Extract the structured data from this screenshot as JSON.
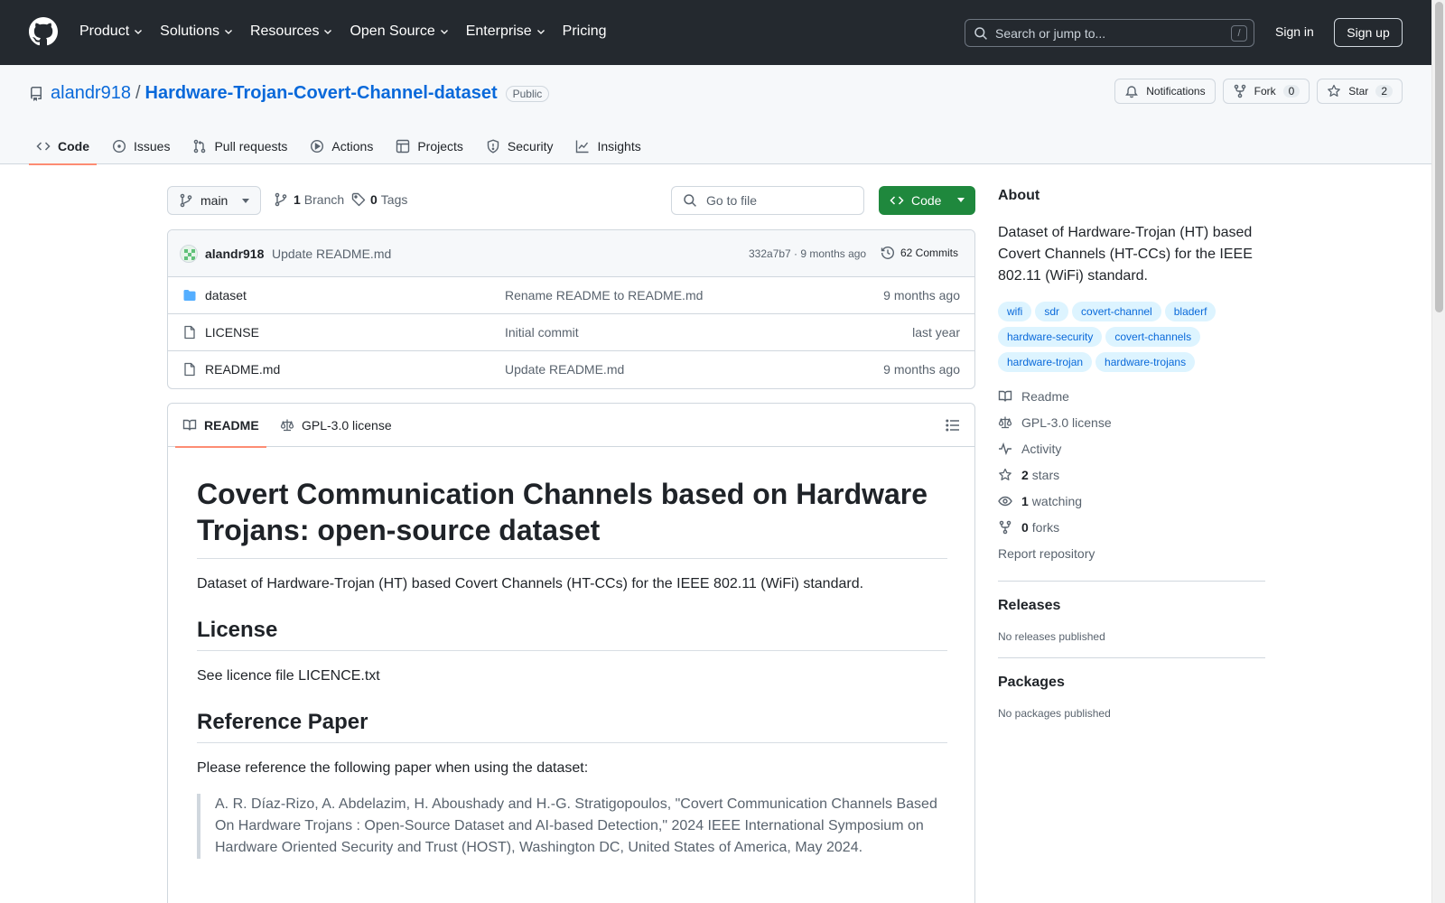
{
  "header": {
    "nav": [
      {
        "label": "Product",
        "has_caret": true
      },
      {
        "label": "Solutions",
        "has_caret": true
      },
      {
        "label": "Resources",
        "has_caret": true
      },
      {
        "label": "Open Source",
        "has_caret": true
      },
      {
        "label": "Enterprise",
        "has_caret": true
      },
      {
        "label": "Pricing",
        "has_caret": false
      }
    ],
    "search_placeholder": "Search or jump to...",
    "search_shortcut": "/",
    "sign_in": "Sign in",
    "sign_up": "Sign up"
  },
  "repo": {
    "owner": "alandr918",
    "separator": "/",
    "name": "Hardware-Trojan-Covert-Channel-dataset",
    "visibility": "Public",
    "actions": {
      "notifications": "Notifications",
      "fork": "Fork",
      "fork_count": "0",
      "star": "Star",
      "star_count": "2"
    },
    "tabs": [
      "Code",
      "Issues",
      "Pull requests",
      "Actions",
      "Projects",
      "Security",
      "Insights"
    ]
  },
  "filebar": {
    "branch": "main",
    "branch_count": "1",
    "branch_label": "Branch",
    "tag_count": "0",
    "tag_label": "Tags",
    "go_to_file": "Go to file",
    "code_button": "Code"
  },
  "latest_commit": {
    "author": "alandr918",
    "message": "Update README.md",
    "meta": "332a7b7 · 9 months ago",
    "commits": "62 Commits"
  },
  "files": [
    {
      "type": "folder",
      "name": "dataset",
      "message": "Rename README to README.md",
      "time": "9 months ago"
    },
    {
      "type": "file",
      "name": "LICENSE",
      "message": "Initial commit",
      "time": "last year"
    },
    {
      "type": "file",
      "name": "README.md",
      "message": "Update README.md",
      "time": "9 months ago"
    }
  ],
  "readme": {
    "tab_readme": "README",
    "tab_license": "GPL-3.0 license",
    "title": "Covert Communication Channels based on Hardware Trojans: open-source dataset",
    "intro": "Dataset of Hardware-Trojan (HT) based Covert Channels (HT-CCs) for the IEEE 802.11 (WiFi) standard.",
    "license_heading": "License",
    "license_text": "See licence file LICENCE.txt",
    "paper_heading": "Reference Paper",
    "paper_text": "Please reference the following paper when using the dataset:",
    "citation": "A. R. Díaz-Rizo, A. Abdelazim, H. Aboushady and H.-G. Stratigopoulos, \"Covert Communication Channels Based On Hardware Trojans : Open-Source Dataset and AI-based Detection,\" 2024 IEEE International Symposium on Hardware Oriented Security and Trust (HOST), Washington DC, United States of America, May 2024."
  },
  "sidebar": {
    "about_heading": "About",
    "description": "Dataset of Hardware-Trojan (HT) based Covert Channels (HT-CCs) for the IEEE 802.11 (WiFi) standard.",
    "topics": [
      "wifi",
      "sdr",
      "covert-channel",
      "bladerf",
      "hardware-security",
      "covert-channels",
      "hardware-trojan",
      "hardware-trojans"
    ],
    "links": {
      "readme": "Readme",
      "license": "GPL-3.0 license",
      "activity": "Activity",
      "stars_count": "2",
      "stars_label": "stars",
      "watching_count": "1",
      "watching_label": "watching",
      "forks_count": "0",
      "forks_label": "forks",
      "report": "Report repository"
    },
    "releases_heading": "Releases",
    "releases_text": "No releases published",
    "packages_heading": "Packages",
    "packages_text": "No packages published"
  },
  "colors": {
    "header_bg": "#24292f",
    "link_blue": "#0969da",
    "green_button": "#1f883d",
    "tab_underline": "#fd8c73",
    "folder_blue": "#54aeff"
  }
}
